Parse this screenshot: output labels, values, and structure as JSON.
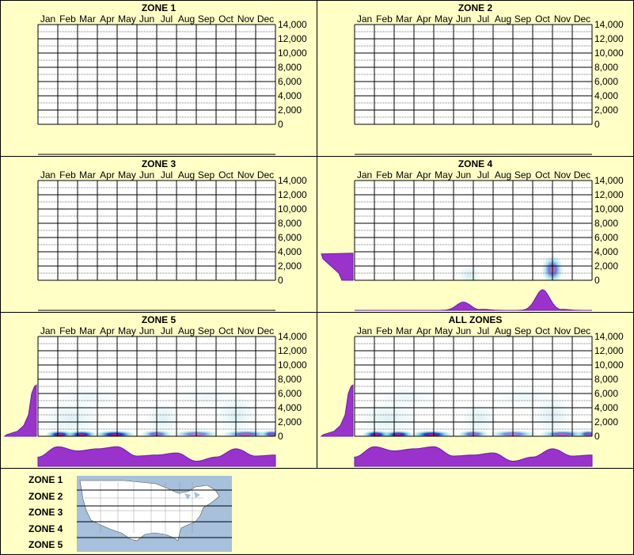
{
  "chart_data": {
    "type": "heatmap",
    "months": [
      "Jan",
      "Feb",
      "Mar",
      "Apr",
      "May",
      "Jun",
      "Jul",
      "Aug",
      "Sep",
      "Oct",
      "Nov",
      "Dec"
    ],
    "y_ticks": [
      "14,000",
      "12,000",
      "10,000",
      "8,000",
      "6,000",
      "4,000",
      "2,000",
      "0"
    ],
    "ylim": [
      0,
      14000
    ],
    "panels": [
      {
        "title": "ZONE 1",
        "monthly_density": [
          0,
          0,
          0,
          0,
          0,
          0,
          0,
          0,
          0,
          0,
          0,
          0
        ],
        "elevation_density": [],
        "hotspots": []
      },
      {
        "title": "ZONE 2",
        "monthly_density": [
          0,
          0,
          0,
          0,
          0,
          0,
          0,
          0,
          0,
          0,
          0,
          0
        ],
        "elevation_density": [],
        "hotspots": []
      },
      {
        "title": "ZONE 3",
        "monthly_density": [
          0,
          0,
          0,
          0,
          0,
          0,
          0,
          0,
          0,
          0,
          0,
          0
        ],
        "elevation_density": [],
        "hotspots": []
      },
      {
        "title": "ZONE 4",
        "monthly_density": [
          0,
          0,
          0,
          0,
          0,
          0.4,
          0.05,
          0,
          0,
          1.0,
          0.05,
          0
        ],
        "elevation_density": [
          {
            "elev": 0,
            "d": 0.35
          },
          {
            "elev": 1000,
            "d": 0.45
          },
          {
            "elev": 2000,
            "d": 0.7
          },
          {
            "elev": 3000,
            "d": 0.95
          },
          {
            "elev": 3700,
            "d": 1.0
          },
          {
            "elev": 3800,
            "d": 0
          }
        ],
        "hotspots": [
          {
            "month": 5.3,
            "elev": 700,
            "intensity": 0.45,
            "sx": 14,
            "sy": 12
          },
          {
            "month": 9.5,
            "elev": 1500,
            "intensity": 0.55,
            "sx": 14,
            "sy": 18
          }
        ]
      },
      {
        "title": "ZONE 5",
        "monthly_density": [
          0.45,
          0.95,
          0.75,
          0.85,
          0.95,
          0.5,
          0.55,
          0.65,
          0.25,
          0.45,
          0.85,
          0.5,
          0.55
        ],
        "elevation_density": [
          {
            "elev": 0,
            "d": 1.0
          },
          {
            "elev": 200,
            "d": 0.95
          },
          {
            "elev": 700,
            "d": 0.6
          },
          {
            "elev": 1500,
            "d": 0.4
          },
          {
            "elev": 3000,
            "d": 0.25
          },
          {
            "elev": 6000,
            "d": 0.15
          },
          {
            "elev": 7000,
            "d": 0.06
          },
          {
            "elev": 7200,
            "d": 0
          }
        ],
        "hotspots": [
          {
            "month": 0.6,
            "elev": 250,
            "intensity": 1.0,
            "sx": 18,
            "sy": 5
          },
          {
            "month": 1.7,
            "elev": 250,
            "intensity": 0.95,
            "sx": 20,
            "sy": 5
          },
          {
            "month": 3.4,
            "elev": 250,
            "intensity": 1.0,
            "sx": 26,
            "sy": 5
          },
          {
            "month": 5.5,
            "elev": 300,
            "intensity": 0.6,
            "sx": 20,
            "sy": 5
          },
          {
            "month": 7.5,
            "elev": 300,
            "intensity": 0.5,
            "sx": 30,
            "sy": 5
          },
          {
            "month": 10.0,
            "elev": 300,
            "intensity": 0.6,
            "sx": 30,
            "sy": 5
          },
          {
            "month": 11.3,
            "elev": 300,
            "intensity": 0.7,
            "sx": 14,
            "sy": 5
          },
          {
            "month": 1.2,
            "elev": 2500,
            "intensity": 0.3,
            "sx": 40,
            "sy": 22
          },
          {
            "month": 5.8,
            "elev": 2500,
            "intensity": 0.3,
            "sx": 22,
            "sy": 22
          },
          {
            "month": 9.5,
            "elev": 3000,
            "intensity": 0.35,
            "sx": 25,
            "sy": 25
          },
          {
            "month": 2.0,
            "elev": 5500,
            "intensity": 0.15,
            "sx": 40,
            "sy": 14
          },
          {
            "month": 8.0,
            "elev": 5500,
            "intensity": 0.12,
            "sx": 40,
            "sy": 14
          }
        ]
      },
      {
        "title": "ALL ZONES",
        "monthly_density": [
          0.45,
          0.95,
          0.75,
          0.85,
          0.95,
          0.5,
          0.55,
          0.65,
          0.25,
          0.45,
          0.85,
          0.5,
          0.55
        ],
        "elevation_density": [
          {
            "elev": 0,
            "d": 1.0
          },
          {
            "elev": 200,
            "d": 0.95
          },
          {
            "elev": 700,
            "d": 0.6
          },
          {
            "elev": 1500,
            "d": 0.4
          },
          {
            "elev": 3000,
            "d": 0.25
          },
          {
            "elev": 6000,
            "d": 0.15
          },
          {
            "elev": 7000,
            "d": 0.06
          },
          {
            "elev": 7200,
            "d": 0
          }
        ],
        "hotspots": [
          {
            "month": 0.6,
            "elev": 250,
            "intensity": 1.0,
            "sx": 18,
            "sy": 5
          },
          {
            "month": 1.7,
            "elev": 250,
            "intensity": 0.95,
            "sx": 20,
            "sy": 5
          },
          {
            "month": 3.4,
            "elev": 250,
            "intensity": 1.0,
            "sx": 26,
            "sy": 5
          },
          {
            "month": 5.5,
            "elev": 300,
            "intensity": 0.6,
            "sx": 20,
            "sy": 5
          },
          {
            "month": 7.5,
            "elev": 300,
            "intensity": 0.5,
            "sx": 30,
            "sy": 5
          },
          {
            "month": 10.0,
            "elev": 300,
            "intensity": 0.6,
            "sx": 30,
            "sy": 5
          },
          {
            "month": 11.3,
            "elev": 300,
            "intensity": 0.7,
            "sx": 14,
            "sy": 5
          },
          {
            "month": 1.2,
            "elev": 2500,
            "intensity": 0.3,
            "sx": 40,
            "sy": 22
          },
          {
            "month": 5.8,
            "elev": 2500,
            "intensity": 0.3,
            "sx": 22,
            "sy": 22
          },
          {
            "month": 9.5,
            "elev": 3000,
            "intensity": 0.35,
            "sx": 25,
            "sy": 25
          },
          {
            "month": 2.0,
            "elev": 5500,
            "intensity": 0.15,
            "sx": 40,
            "sy": 14
          },
          {
            "month": 8.0,
            "elev": 5500,
            "intensity": 0.12,
            "sx": 40,
            "sy": 14
          }
        ]
      }
    ]
  },
  "legend": {
    "zones": [
      "ZONE 1",
      "ZONE 2",
      "ZONE 3",
      "ZONE 4",
      "ZONE 5"
    ]
  },
  "colors": {
    "background": "#ffffc6",
    "density": "#9933cc",
    "density_dark": "#6a1fb0",
    "hot": "#ff0080",
    "mid": "#0033cc",
    "low": "#66ccdd",
    "map_water": "#a7c0db",
    "map_land": "#ffffff"
  }
}
